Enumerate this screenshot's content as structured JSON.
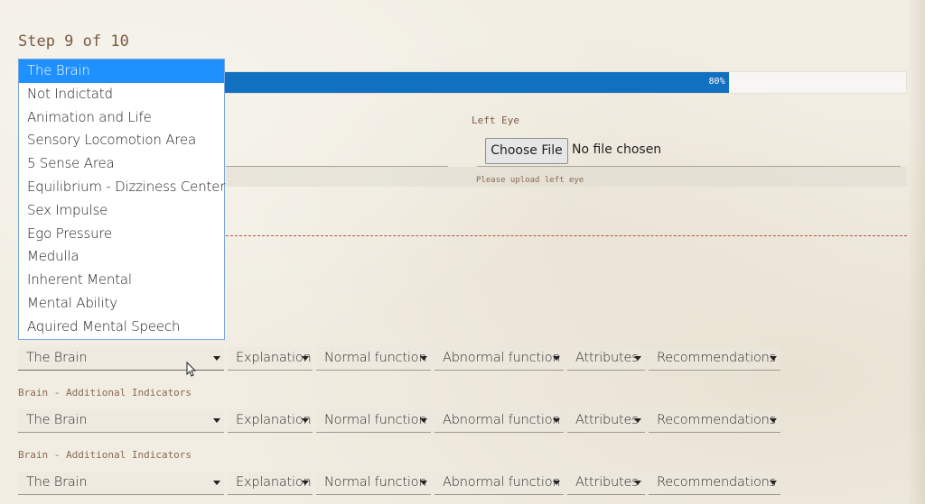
{
  "step": {
    "title": "Step 9 of 10"
  },
  "progress": {
    "label": "80%",
    "value": 80
  },
  "left_eye": {
    "label": "Left Eye",
    "button": "Choose File",
    "status": "No file chosen",
    "help": "Please upload left eye"
  },
  "dropdown": {
    "options": [
      "The Brain",
      "Not Indictatd",
      "Animation and Life",
      "Sensory Locomotion Area",
      "5 Sense Area",
      "Equilibrium - Dizziness Center",
      "Sex Impulse",
      "Ego Pressure",
      "Medulla",
      "Inherent Mental",
      "Mental Ability",
      "Aquired Mental Speech"
    ]
  },
  "rows": [
    {
      "area": "The Brain",
      "explanation": "Explanation",
      "normal": "Normal function",
      "abnormal": "Abnormal function",
      "attributes": "Attributes",
      "recommendations": "Recommendations"
    },
    {
      "area": "The Brain",
      "explanation": "Explanation",
      "normal": "Normal function",
      "abnormal": "Abnormal function",
      "attributes": "Attributes",
      "recommendations": "Recommendations"
    },
    {
      "area": "The Brain",
      "explanation": "Explanation",
      "normal": "Normal function",
      "abnormal": "Abnormal function",
      "attributes": "Attributes",
      "recommendations": "Recommendations"
    }
  ],
  "sections": [
    {
      "label": "Brain - Additional Indicators"
    },
    {
      "label": "Brain - Additional Indicators"
    }
  ]
}
